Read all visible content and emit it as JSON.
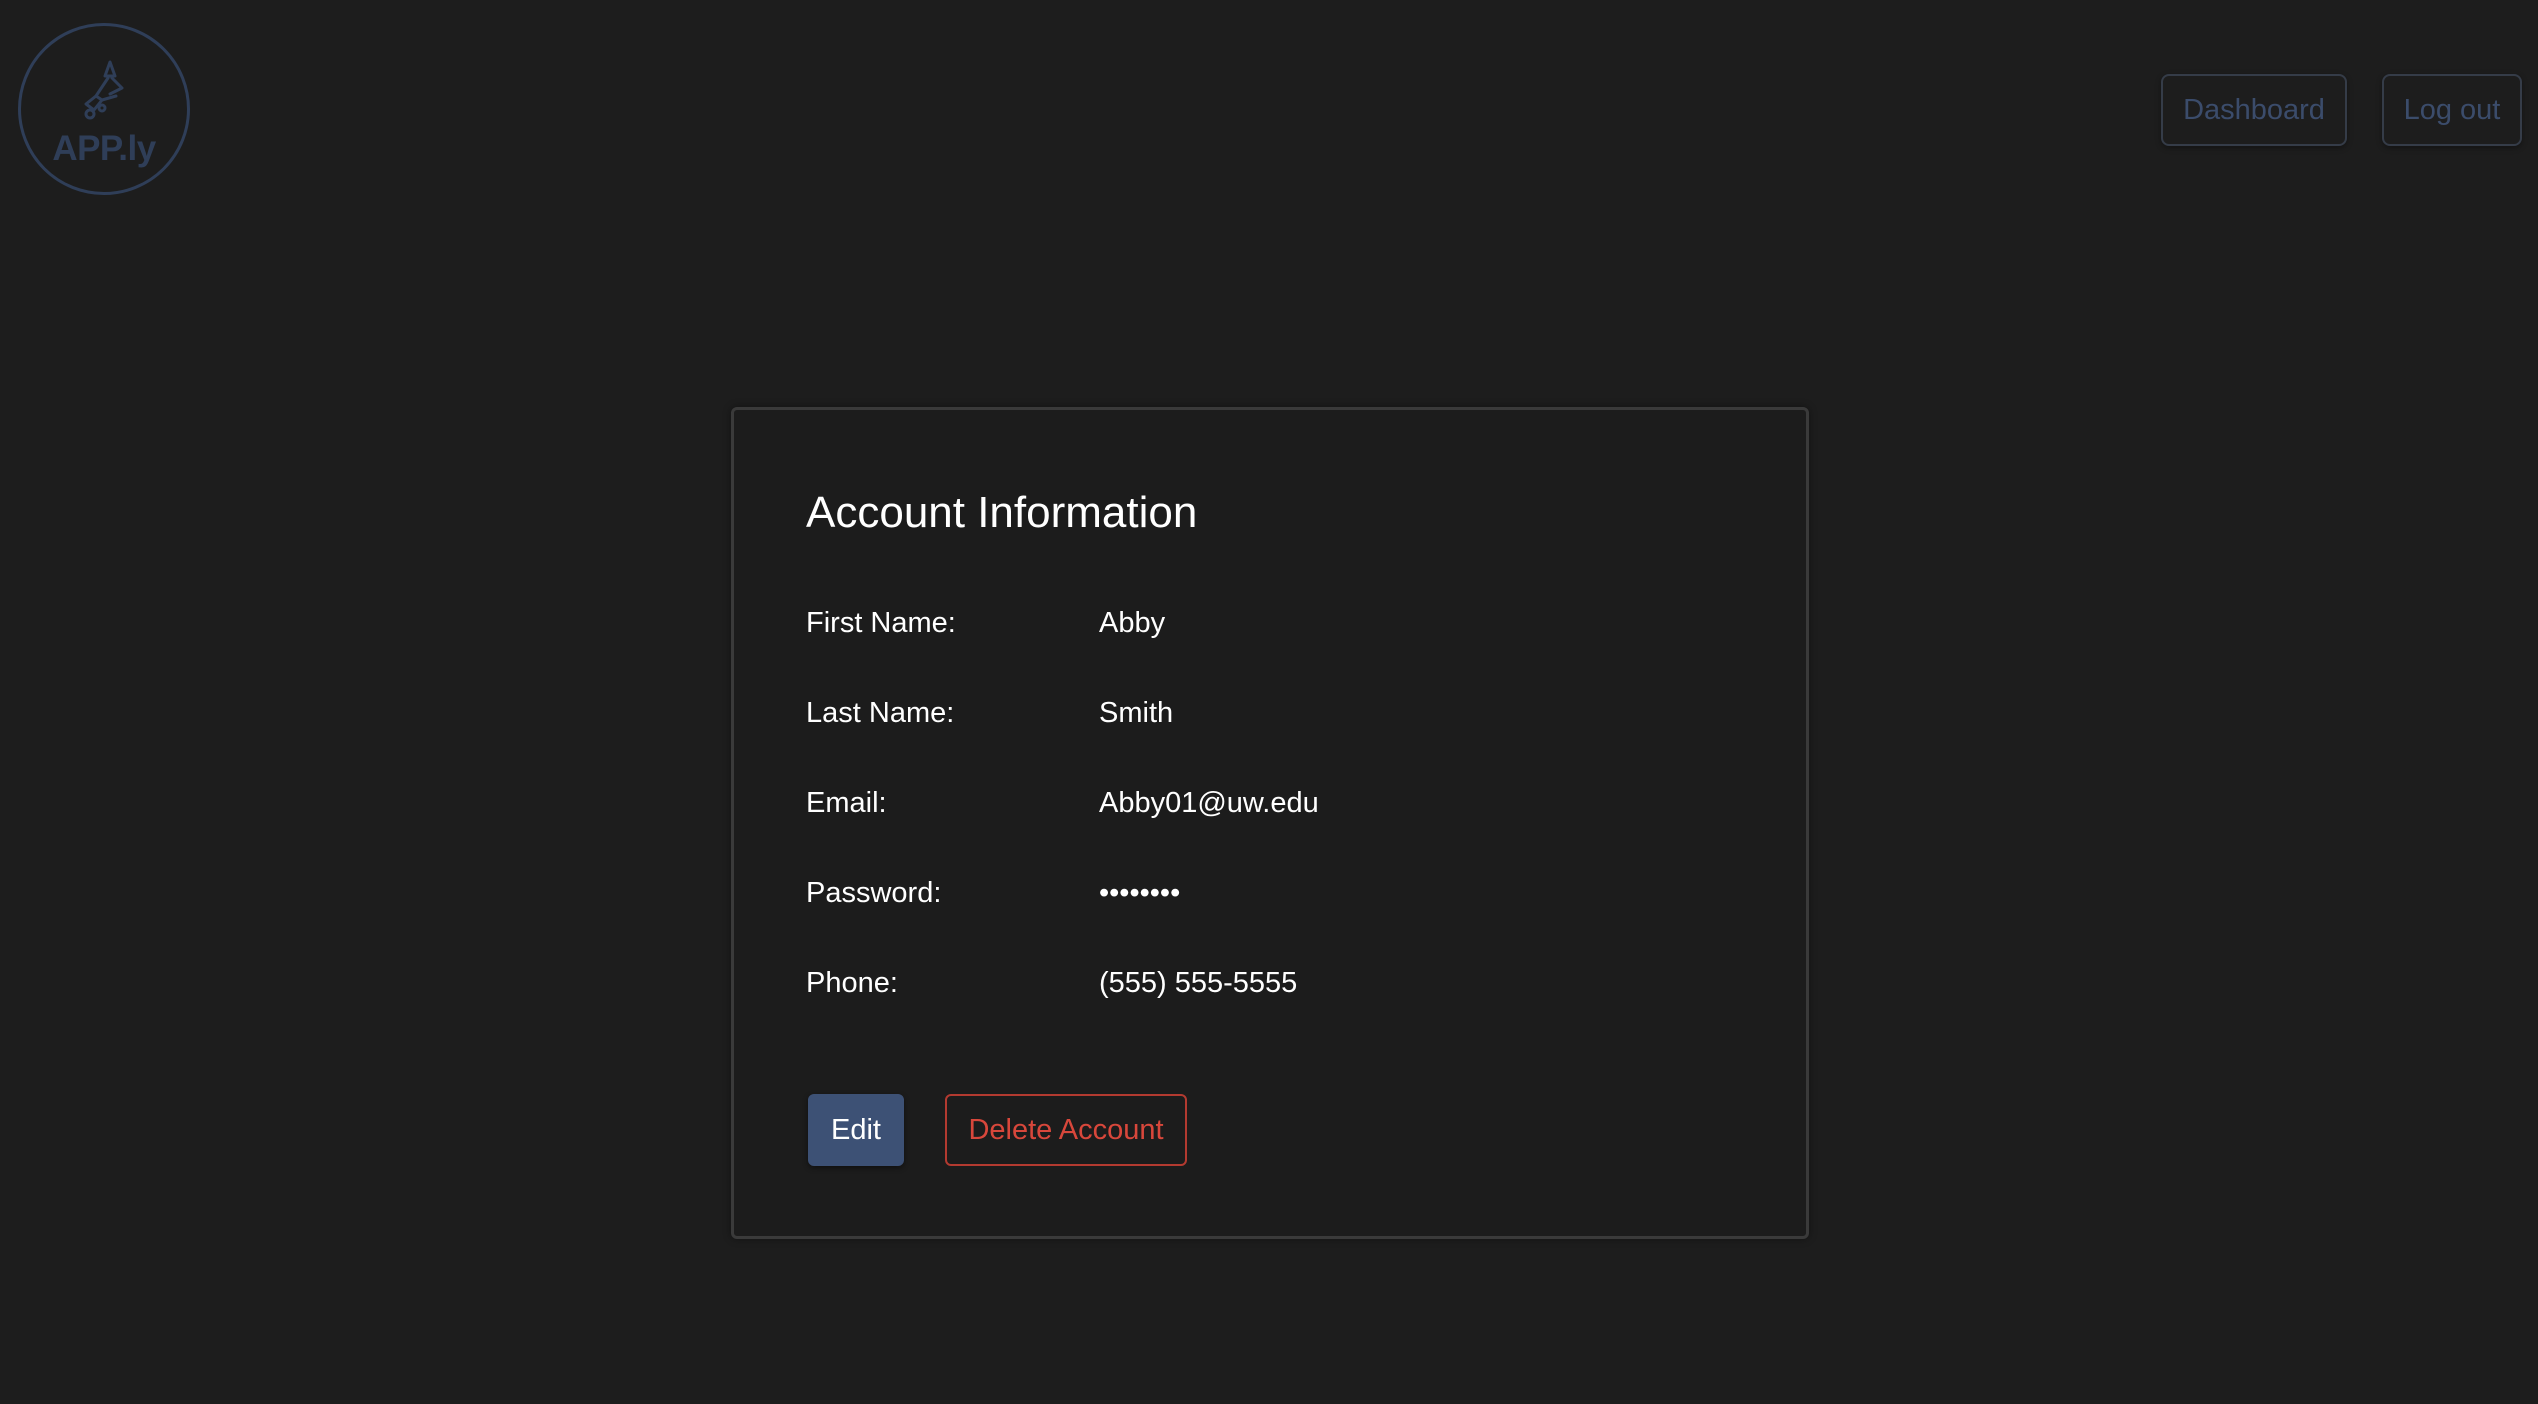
{
  "logo": {
    "text": "APP.ly",
    "icon": "music-note-icon",
    "color": "#2f3e58"
  },
  "nav": {
    "dashboard_label": "Dashboard",
    "logout_label": "Log out"
  },
  "account": {
    "title": "Account Information",
    "fields": [
      {
        "label": "First Name:",
        "value": "Abby"
      },
      {
        "label": "Last Name:",
        "value": "Smith"
      },
      {
        "label": "Email:",
        "value": "Abby01@uw.edu"
      },
      {
        "label": "Password:",
        "value": "••••••••"
      },
      {
        "label": "Phone:",
        "value": "(555) 555-5555"
      }
    ],
    "edit_label": "Edit",
    "delete_label": "Delete Account"
  },
  "colors": {
    "background": "#1d1d1d",
    "accent": "#3d5175",
    "danger": "#d8473b"
  }
}
